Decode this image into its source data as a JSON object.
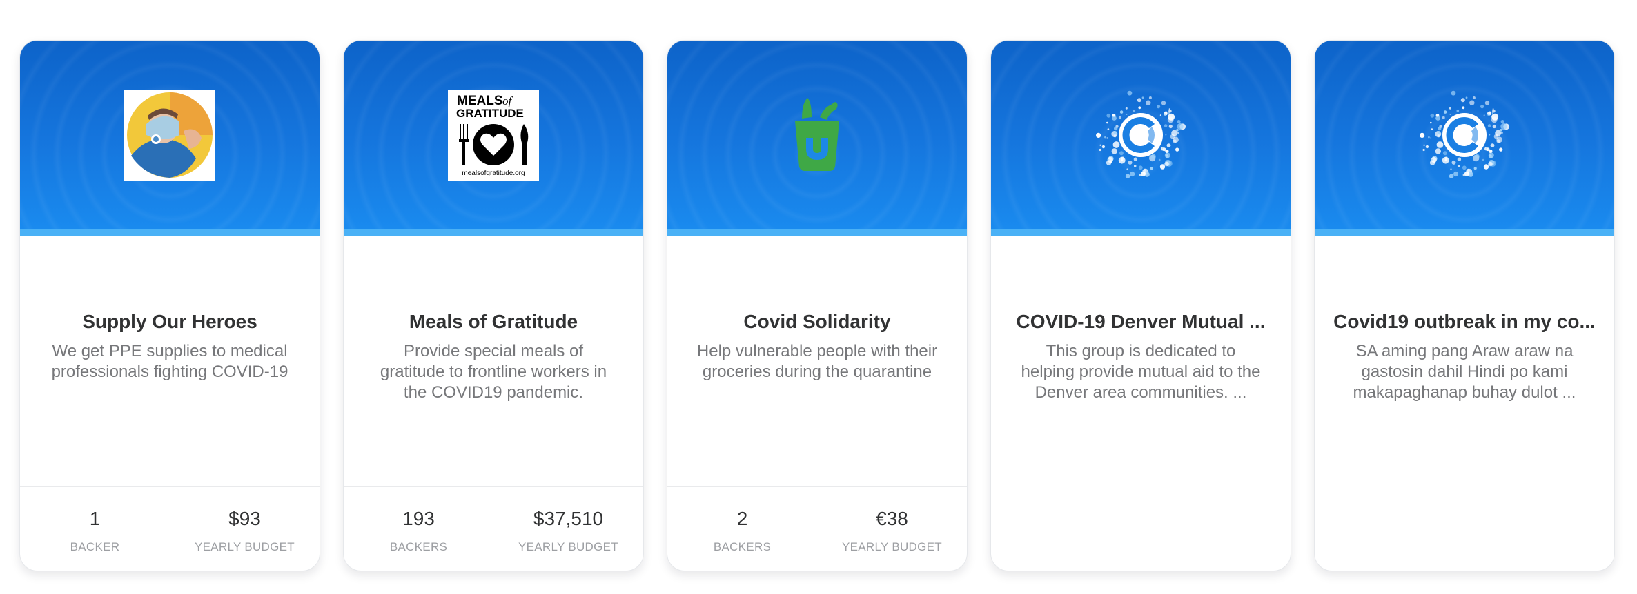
{
  "cards": [
    {
      "logo_icon": "supply-our-heroes-logo",
      "title": "Supply Our Heroes",
      "description": "We get PPE supplies to medical professionals fighting COVID-19",
      "backers_value": "1",
      "backers_label": "BACKER",
      "budget_value": "$93",
      "budget_label": "YEARLY BUDGET"
    },
    {
      "logo_icon": "meals-of-gratitude-logo",
      "logo_text_line1": "MEALS",
      "logo_text_of": "of",
      "logo_text_line2": "GRATITUDE",
      "logo_url": "mealsofgratitude.org",
      "title": "Meals of Gratitude",
      "description": "Provide special meals of gratitude to frontline workers in the COVID19 pandemic.",
      "backers_value": "193",
      "backers_label": "BACKERS",
      "budget_value": "$37,510",
      "budget_label": "YEARLY BUDGET"
    },
    {
      "logo_icon": "grocery-bag-logo",
      "title": "Covid Solidarity",
      "description": "Help vulnerable people with their groceries during the quarantine",
      "backers_value": "2",
      "backers_label": "BACKERS",
      "budget_value": "€38",
      "budget_label": "YEARLY BUDGET"
    },
    {
      "logo_icon": "opencollective-covid-logo",
      "title": "COVID-19 Denver Mutual ...",
      "description": "This group is dedicated to helping provide mutual aid to the Denver area communities. ..."
    },
    {
      "logo_icon": "opencollective-covid-logo",
      "title": "Covid19 outbreak in my co...",
      "description": "SA aming pang Araw araw na gastosin dahil Hindi po kami makapaghanap buhay dulot ..."
    }
  ],
  "colors": {
    "banner_top": "#0d63c9",
    "banner_bottom": "#1a8cf0",
    "banner_stripe": "#4ab1f6",
    "grocery_green": "#3fa846",
    "title_text": "#313233",
    "description_text": "#76777a",
    "label_text": "#9d9fa3"
  }
}
